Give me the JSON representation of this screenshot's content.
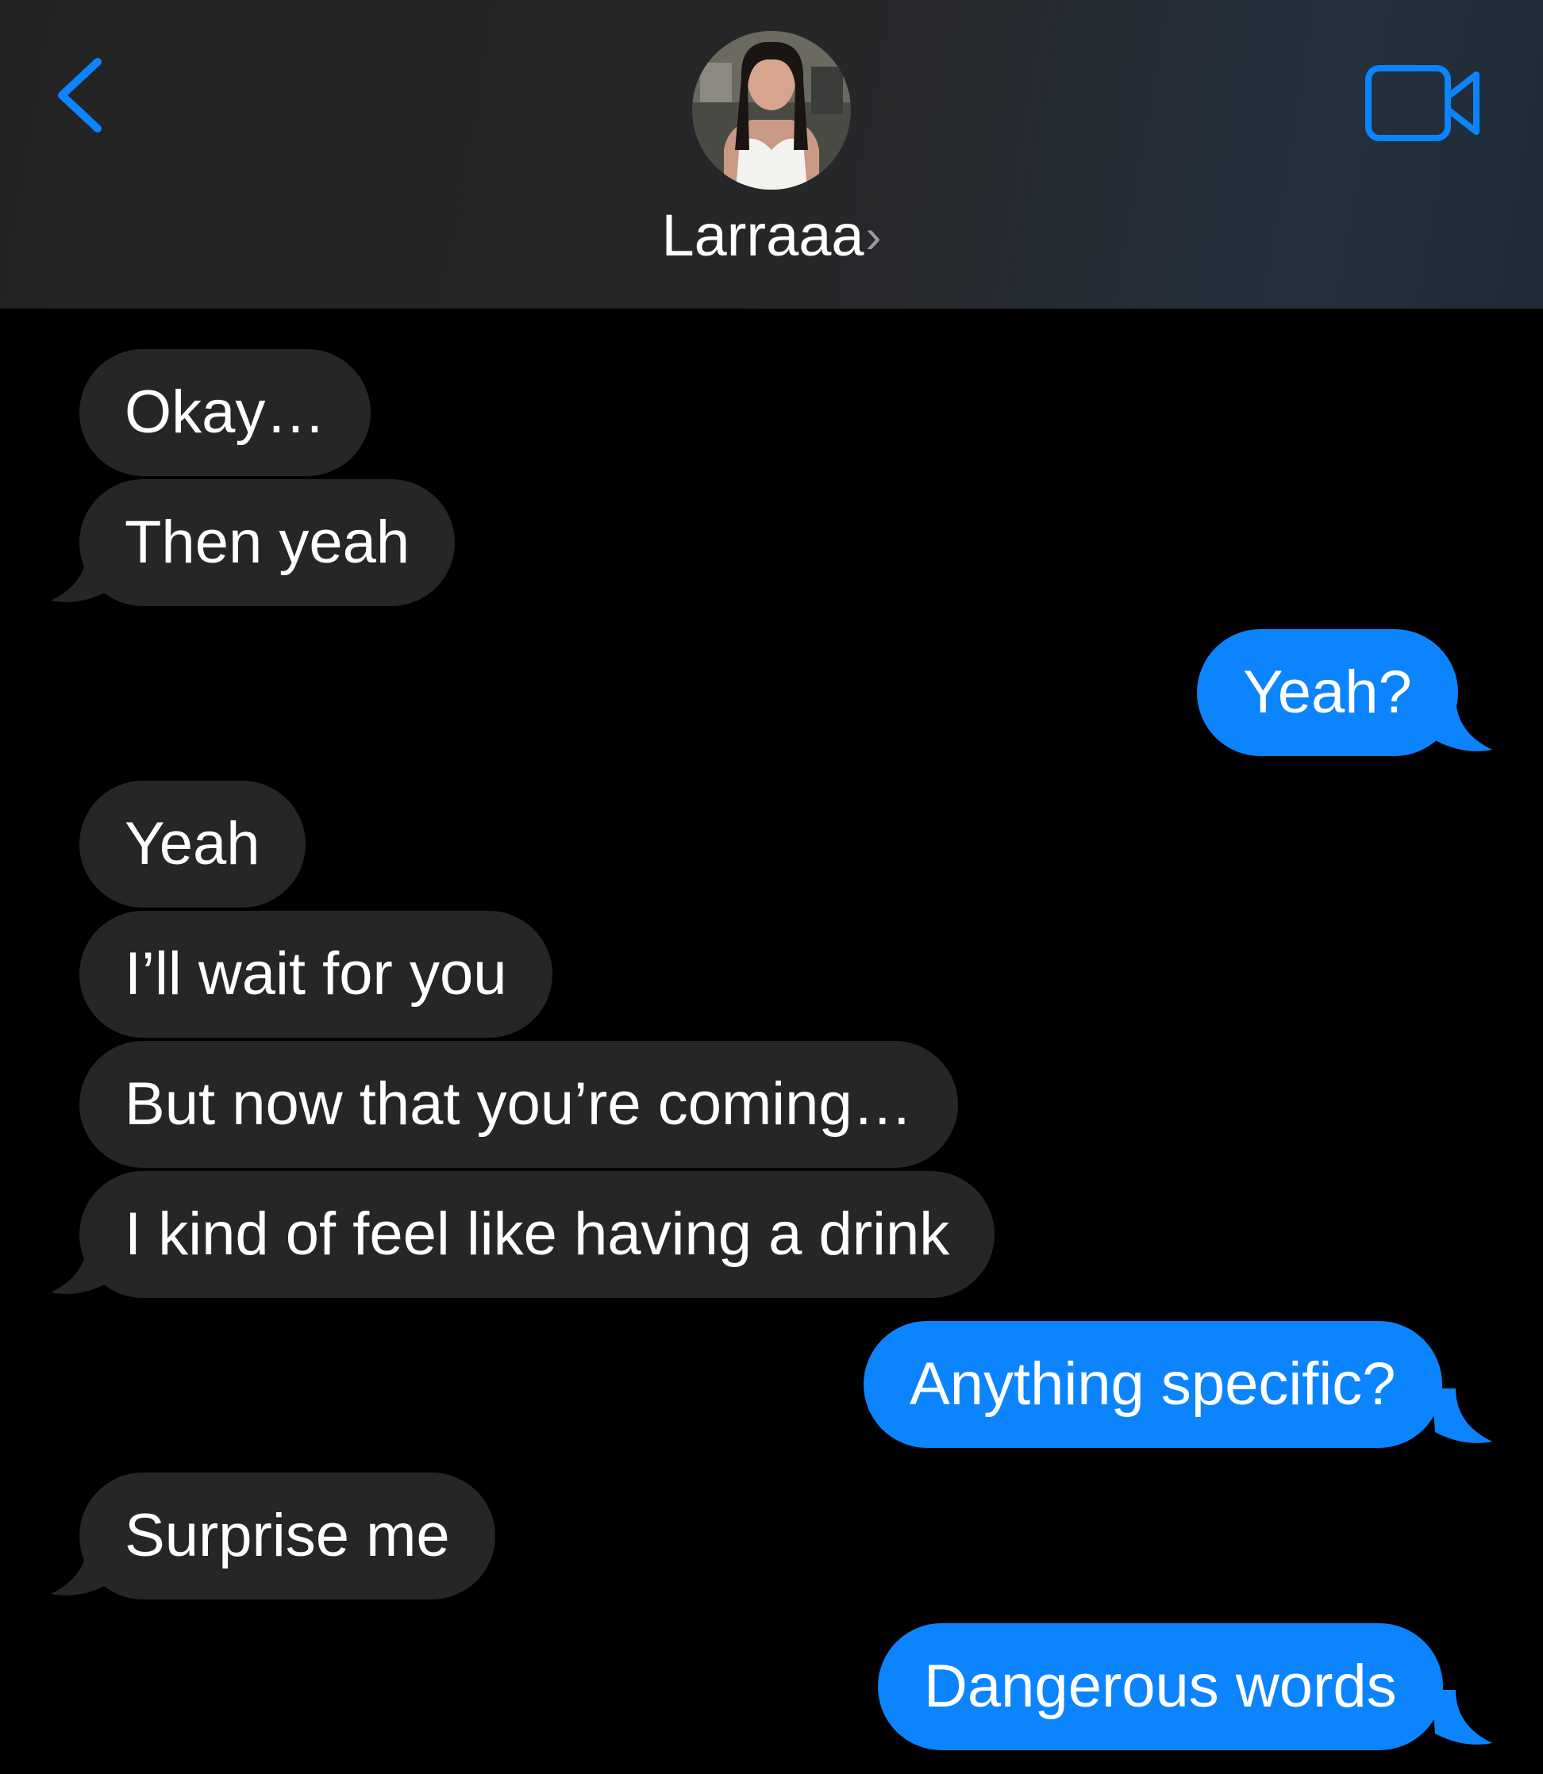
{
  "header": {
    "contact_name": "Larraaa",
    "chevron": "›",
    "back_icon": "chevron-left-icon",
    "video_icon": "video-camera-icon",
    "accent_color": "#0b84fe"
  },
  "messages": [
    {
      "direction": "incoming",
      "text": "Okay…",
      "tail": false
    },
    {
      "direction": "incoming",
      "text": "Then yeah",
      "tail": true
    },
    {
      "direction": "outgoing",
      "text": "Yeah?",
      "tail": true
    },
    {
      "direction": "incoming",
      "text": "Yeah",
      "tail": false
    },
    {
      "direction": "incoming",
      "text": "I’ll wait for you",
      "tail": false
    },
    {
      "direction": "incoming",
      "text": "But now that you’re coming…",
      "tail": false
    },
    {
      "direction": "incoming",
      "text": "I kind of feel like having a drink",
      "tail": true
    },
    {
      "direction": "outgoing",
      "text": "Anything specific?",
      "tail": true
    },
    {
      "direction": "incoming",
      "text": "Surprise me",
      "tail": true
    },
    {
      "direction": "outgoing",
      "text": "Dangerous words",
      "tail": true
    }
  ],
  "colors": {
    "incoming_bubble": "#262628",
    "outgoing_bubble": "#0b84fe",
    "background": "#000000",
    "text": "#ffffff"
  }
}
